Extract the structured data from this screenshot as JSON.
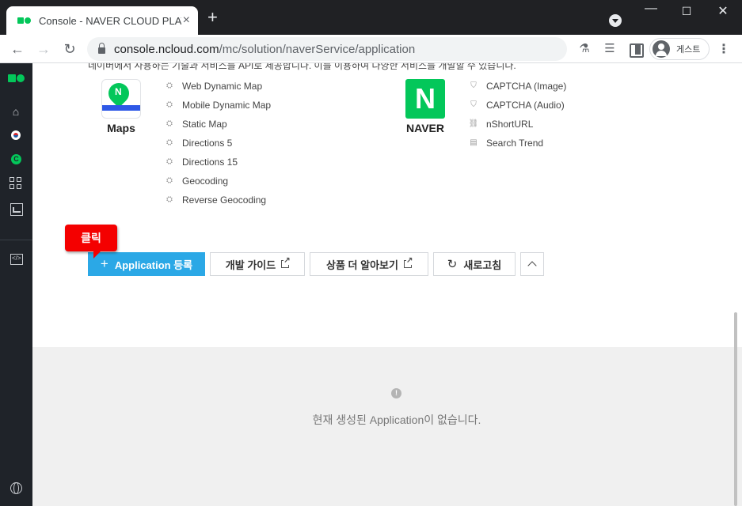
{
  "browser": {
    "tab_title": "Console - NAVER CLOUD PLATFORM",
    "tab_close": "×",
    "new_tab": "+",
    "url_host": "console.ncloud.com",
    "url_path": "/mc/solution/naverService/application",
    "profile_label": "게스트"
  },
  "page": {
    "intro_text": "네이버에서 사용하는 기술과 서비스를 API로 제공합니다. 이를 이용하여 다양한 서비스를 개발할 수 있습니다.",
    "maps": {
      "name": "Maps",
      "icon_letter": "N",
      "apis": [
        "Web Dynamic Map",
        "Mobile Dynamic Map",
        "Static Map",
        "Directions 5",
        "Directions 15",
        "Geocoding",
        "Reverse Geocoding"
      ]
    },
    "naver": {
      "name": "NAVER",
      "icon_letter": "N",
      "apis": [
        "CAPTCHA (Image)",
        "CAPTCHA (Audio)",
        "nShortURL",
        "Search Trend"
      ]
    },
    "buttons": {
      "register": "Application 등록",
      "guide": "개발 가이드",
      "more": "상품 더 알아보기",
      "refresh": "새로고침"
    },
    "callout": "클릭",
    "empty_message": "현재 생성된 Application이 없습니다."
  },
  "colors": {
    "brand_green": "#03c75a",
    "primary_blue": "#2ba8e6",
    "callout_red": "#f40000",
    "sidebar_bg": "#1f2329"
  }
}
